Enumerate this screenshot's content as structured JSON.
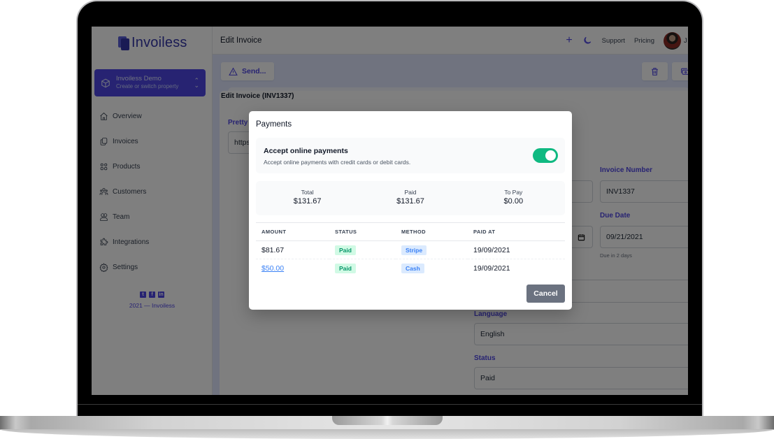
{
  "app": {
    "brand": "Invoiless",
    "property_switcher": {
      "name": "Invoiless Demo",
      "subtitle": "Create or switch property"
    },
    "sidebar": {
      "items": [
        {
          "label": "Overview",
          "icon": "home-icon"
        },
        {
          "label": "Invoices",
          "icon": "documents-icon"
        },
        {
          "label": "Products",
          "icon": "grid-icon"
        },
        {
          "label": "Customers",
          "icon": "user-group-icon"
        },
        {
          "label": "Team",
          "icon": "users-icon"
        },
        {
          "label": "Integrations",
          "icon": "puzzle-icon"
        },
        {
          "label": "Settings",
          "icon": "cog-icon"
        }
      ],
      "social": [
        "twitter",
        "facebook",
        "linkedin"
      ],
      "footer": "2021 — Invoiless"
    },
    "header": {
      "title": "Edit Invoice",
      "links": [
        "Support",
        "Pricing"
      ],
      "user_initial": "J"
    },
    "toolbar": {
      "send_label": "Send..."
    },
    "form": {
      "title": "Edit Invoice (INV1337)",
      "pretty_label": "Pretty",
      "pretty_value": "https:",
      "invoice_number_label": "Invoice Number",
      "invoice_number_value": "INV1337",
      "due_date_label": "Due Date",
      "due_date_value": "09/21/2021",
      "due_hint": "Due in 2 days",
      "language_label": "Language",
      "language_value": "English",
      "status_label": "Status",
      "status_value": "Paid"
    }
  },
  "modal": {
    "title": "Payments",
    "accept_title": "Accept online payments",
    "accept_subtitle": "Accept online payments with credit cards or debit cards.",
    "accept_enabled": true,
    "totals": [
      {
        "label": "Total",
        "value": "$131.67"
      },
      {
        "label": "Paid",
        "value": "$131.67"
      },
      {
        "label": "To Pay",
        "value": "$0.00"
      }
    ],
    "table": {
      "headers": [
        "AMOUNT",
        "STATUS",
        "METHOD",
        "PAID AT"
      ],
      "rows": [
        {
          "amount": "$81.67",
          "status": "Paid",
          "method": "Stripe",
          "paid_at": "19/09/2021"
        },
        {
          "amount": "$50.00",
          "status": "Paid",
          "method": "Cash",
          "paid_at": "19/09/2021"
        }
      ]
    },
    "cancel_label": "Cancel"
  },
  "colors": {
    "accent": "#4f46e5",
    "toggle_on": "#10b981",
    "paid_badge_bg": "#d1fae5",
    "method_badge_bg": "#dbeafe",
    "cancel_button": "#6b7280"
  }
}
